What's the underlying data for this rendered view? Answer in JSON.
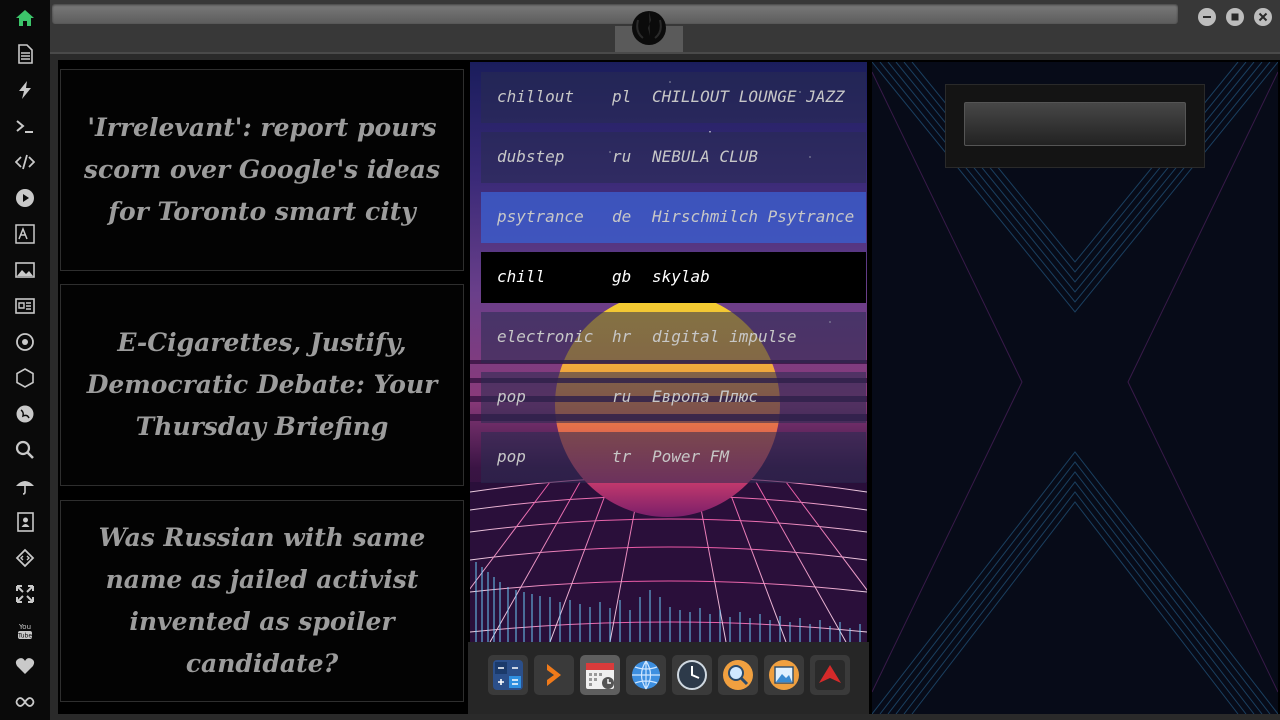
{
  "news": [
    {
      "headline": "'Irrelevant': report pours scorn over Google's ideas for Toronto smart city"
    },
    {
      "headline": "E-Cigarettes, Justify, Democratic Debate: Your Thursday Briefing"
    },
    {
      "headline": "Was Russian with same name as jailed activist invented as spoiler candidate?"
    }
  ],
  "stations": [
    {
      "genre": "chillout",
      "country": "pl",
      "name": "CHILLOUT LOUNGE JAZZ"
    },
    {
      "genre": "dubstep",
      "country": "ru",
      "name": "NEBULA CLUB"
    },
    {
      "genre": "psytrance",
      "country": "de",
      "name": "Hirschmilch Psytrance"
    },
    {
      "genre": "chill",
      "country": "gb",
      "name": "skylab"
    },
    {
      "genre": "electronic",
      "country": "hr",
      "name": "digital impulse"
    },
    {
      "genre": "pop",
      "country": "ru",
      "name": "Европа Плюс"
    },
    {
      "genre": "pop",
      "country": "tr",
      "name": "Power FM"
    }
  ],
  "selected_station_index": 2,
  "current_station_index": 3,
  "sidebar": [
    "home-icon",
    "document-icon",
    "bolt-icon",
    "terminal-icon",
    "code-icon",
    "play-icon",
    "translate-icon",
    "image-icon",
    "news-icon",
    "aperture-icon",
    "hexagon-icon",
    "globe-icon",
    "search-icon",
    "umbrella-icon",
    "contacts-icon",
    "diamond-code-icon",
    "fullscreen-icon",
    "youtube-icon",
    "heart-icon",
    "infinity-icon"
  ],
  "dock": [
    "calculator-icon",
    "terminal-arrow-icon",
    "calendar-icon",
    "globe-icon",
    "clock-icon",
    "search-icon",
    "image-viewer-icon",
    "arrow-up-icon"
  ],
  "colors": {
    "accent": "#3cc46a",
    "selected": "#3c5ac8"
  }
}
